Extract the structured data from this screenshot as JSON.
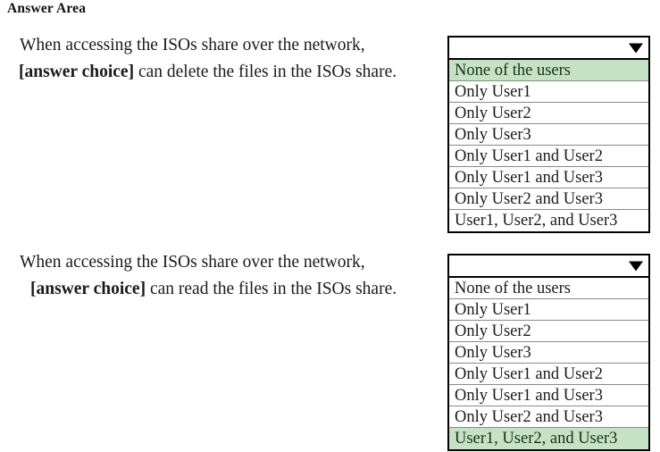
{
  "header": {
    "title": "Answer Area"
  },
  "colors": {
    "highlight_green": "#c6e2c5",
    "border": "#000000",
    "row_divider": "#8a8a8a",
    "text": "#1a1a1a",
    "background": "#ffffff"
  },
  "icons": {
    "caret": "caret-down-icon"
  },
  "questions": [
    {
      "line1": "When accessing the ISOs share over the network,",
      "line2_bold": "[answer choice]",
      "line2_rest": " can delete the files in the ISOs share.",
      "dropdown": {
        "selected_value": "",
        "placeholder": "",
        "expanded": true,
        "options": [
          "None of the users",
          "Only User1",
          "Only User2",
          "Only User3",
          "Only User1 and User2",
          "Only User1 and User3",
          "Only User2 and User3",
          "User1, User2, and User3"
        ],
        "highlighted_option_index": 0
      }
    },
    {
      "line1": "When accessing the ISOs share over the network,",
      "line2_bold": "[answer choice]",
      "line2_rest": " can read the files in the ISOs share.",
      "dropdown": {
        "selected_value": "",
        "placeholder": "",
        "expanded": true,
        "options": [
          "None of the users",
          "Only User1",
          "Only User2",
          "Only User3",
          "Only User1 and User2",
          "Only User1 and User3",
          "Only User2 and User3",
          "User1, User2, and User3"
        ],
        "highlighted_option_index": 7
      }
    }
  ]
}
